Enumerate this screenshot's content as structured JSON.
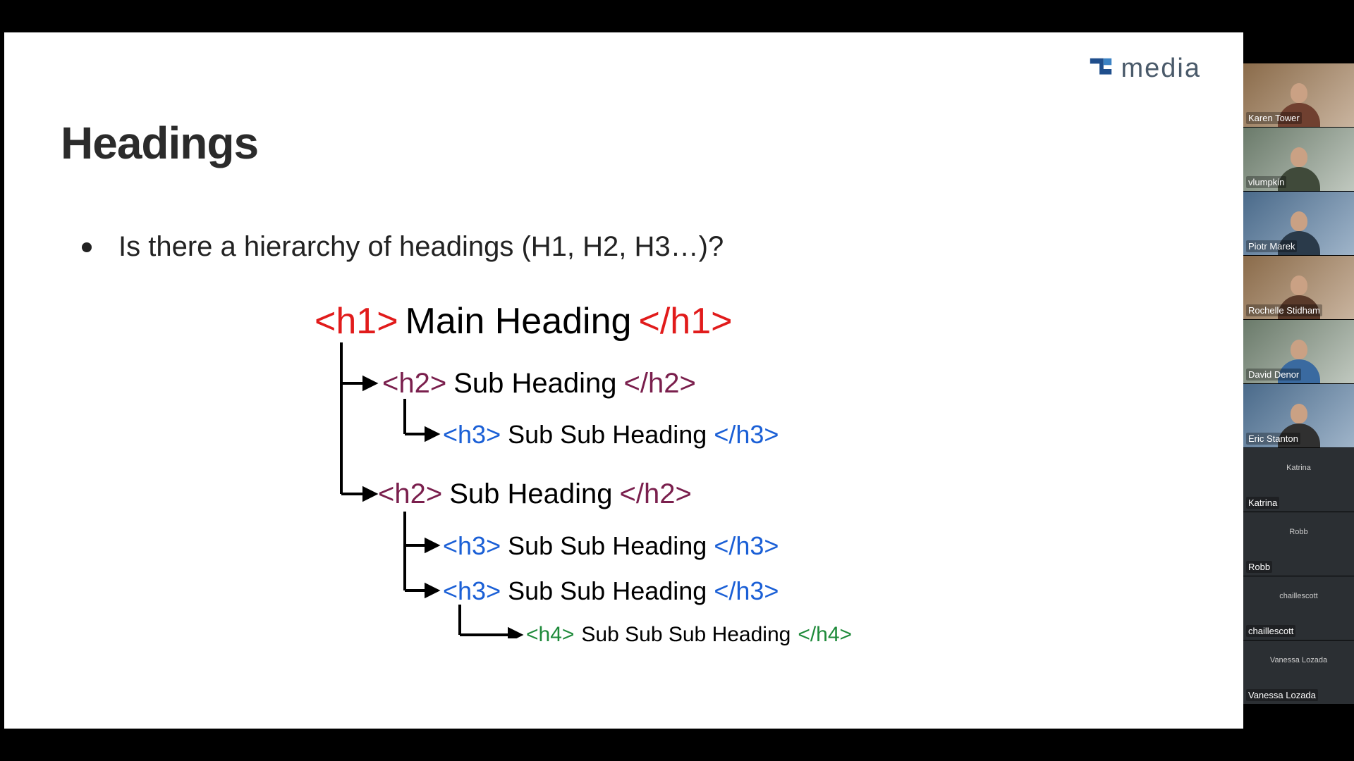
{
  "logo": {
    "text": "media"
  },
  "slide": {
    "title": "Headings",
    "bullet": "Is there a hierarchy of headings (H1, H2, H3…)?"
  },
  "diagram": {
    "h1": {
      "open": "<h1>",
      "text": " Main Heading ",
      "close": "</h1>"
    },
    "h2a": {
      "open": "<h2>",
      "text": " Sub Heading ",
      "close": "</h2>"
    },
    "h3a": {
      "open": "<h3>",
      "text": " Sub Sub Heading ",
      "close": "</h3>"
    },
    "h2b": {
      "open": "<h2>",
      "text": " Sub Heading ",
      "close": "</h2>"
    },
    "h3b": {
      "open": "<h3>",
      "text": " Sub Sub Heading ",
      "close": "</h3>"
    },
    "h3c": {
      "open": "<h3>",
      "text": " Sub Sub Heading ",
      "close": "</h3>"
    },
    "h4": {
      "open": "<h4>",
      "text": " Sub Sub Sub Heading ",
      "close": "</h4>"
    }
  },
  "participants": [
    {
      "name": "Karen Tower",
      "camera": true,
      "tone": "warm"
    },
    {
      "name": "vlumpkin",
      "camera": true,
      "tone": "office"
    },
    {
      "name": "Piotr Marek",
      "camera": true,
      "tone": "blueish"
    },
    {
      "name": "Rochelle Stidham",
      "camera": true,
      "tone": "warm"
    },
    {
      "name": "David Denor",
      "camera": true,
      "tone": "office"
    },
    {
      "name": "Eric Stanton",
      "camera": true,
      "tone": "blueish"
    },
    {
      "name": "Katrina",
      "camera": false
    },
    {
      "name": "Robb",
      "camera": false
    },
    {
      "name": "chaillescott",
      "camera": false
    },
    {
      "name": "Vanessa Lozada",
      "camera": false
    }
  ]
}
